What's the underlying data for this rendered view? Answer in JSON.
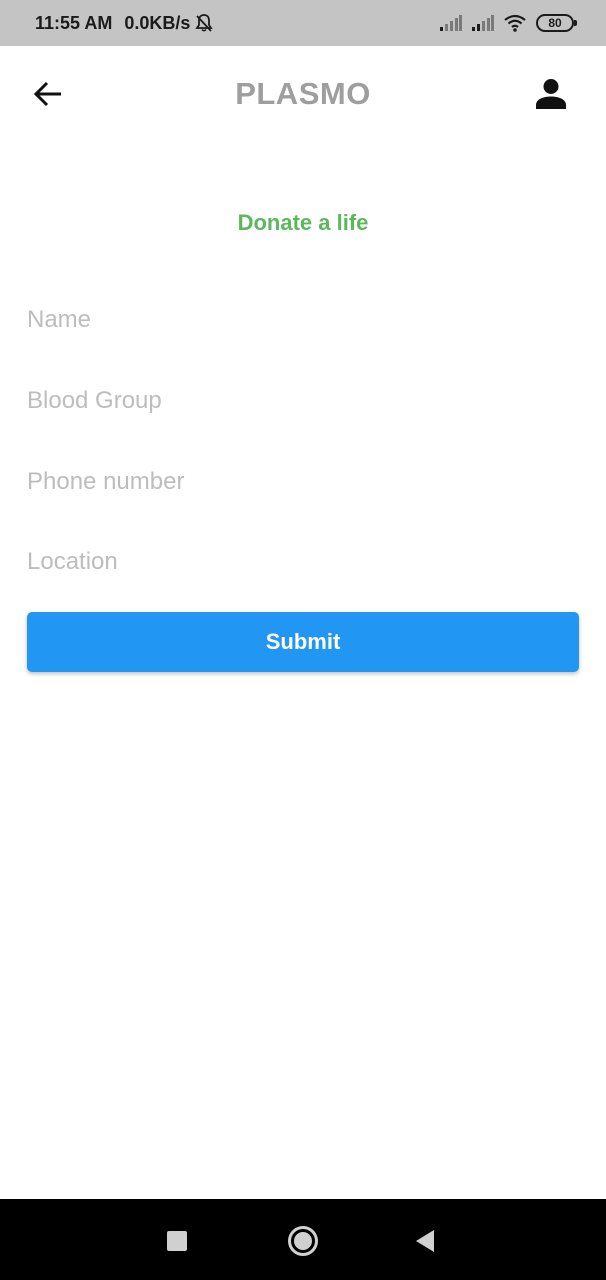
{
  "status_bar": {
    "time": "11:55 AM",
    "speed": "0.0KB/s",
    "battery": "80",
    "icons": [
      "bell-off-icon",
      "signal-icon",
      "signal-icon",
      "wifi-icon",
      "battery-icon"
    ]
  },
  "app_bar": {
    "title": "PLASMO",
    "back_icon": "arrow-left-icon",
    "profile_icon": "person-icon"
  },
  "page": {
    "subtitle": "Donate a life"
  },
  "form": {
    "name_placeholder": "Name",
    "blood_group_placeholder": "Blood Group",
    "phone_placeholder": "Phone number",
    "location_placeholder": "Location",
    "submit_label": "Submit"
  },
  "nav_bar": {
    "icons": [
      "recents-icon",
      "home-icon",
      "back-icon"
    ]
  },
  "colors": {
    "status_bar_bg": "#c4c4c4",
    "title": "#9e9e9e",
    "subtitle": "#5cb85c",
    "placeholder": "#bdbdbd",
    "button": "#2196f3",
    "nav_bar_bg": "#000000"
  }
}
